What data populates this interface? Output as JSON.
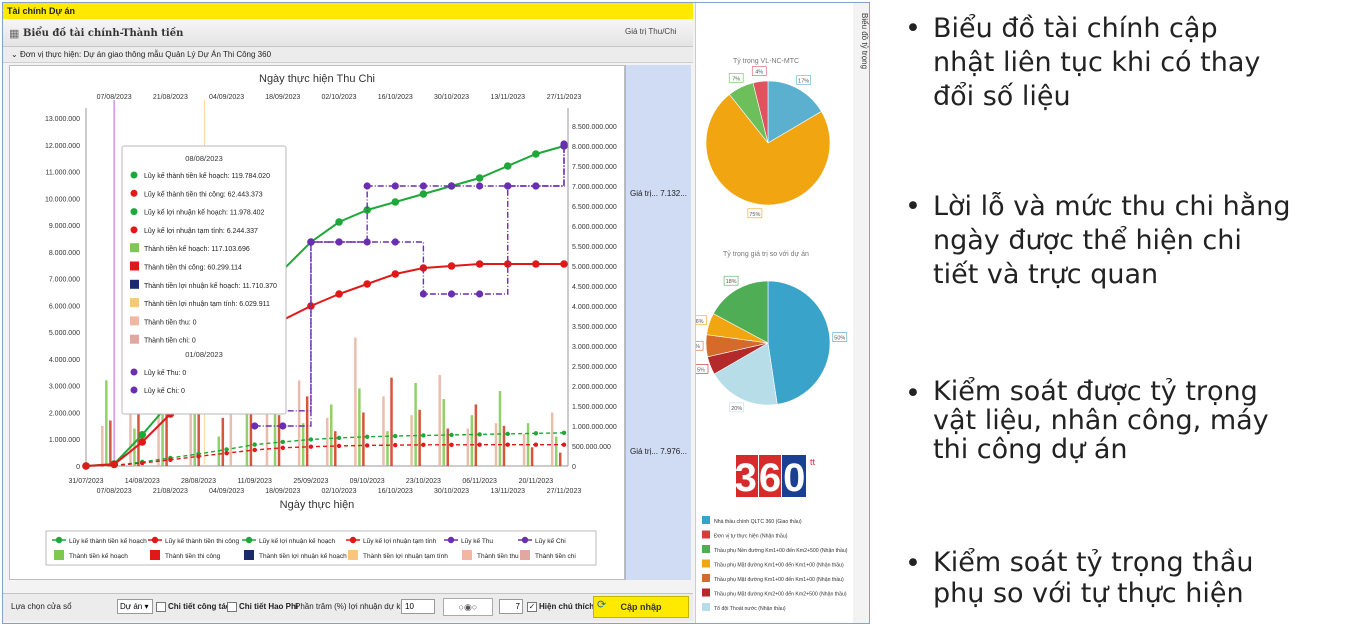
{
  "window": {
    "title": "Tài chính Dự án"
  },
  "panel": {
    "title": "Biểu đồ tài chính-Thành tiền",
    "value_column_header": "Giá trị Thu/Chi",
    "unit_label": "Đơn vị thực hiện: Dự án giao thông mẫu Quản Lý Dự Án Thi Công 360",
    "side_tab_label": "Biểu đồ tỷ trọng"
  },
  "value_column": {
    "row1": "Giá trị... 7.132...",
    "row2": "Giá trị... 7.976..."
  },
  "chart_data": {
    "type": "line",
    "title": "Ngày thực hiện Thu Chi",
    "xlabel": "Ngày thực hiện",
    "x_ticks_top": [
      "07/08/2023",
      "21/08/2023",
      "04/09/2023",
      "18/09/2023",
      "02/10/2023",
      "16/10/2023",
      "30/10/2023",
      "13/11/2023",
      "27/11/2023"
    ],
    "x_ticks_bottom_a": [
      "31/07/2023",
      "14/08/2023",
      "28/08/2023",
      "11/09/2023",
      "25/09/2023",
      "09/10/2023",
      "23/10/2023",
      "06/11/2023",
      "20/11/2023"
    ],
    "x_ticks_bottom_b": [
      "07/08/2023",
      "21/08/2023",
      "04/09/2023",
      "18/09/2023",
      "02/10/2023",
      "16/10/2023",
      "30/10/2023",
      "13/11/2023",
      "27/11/2023"
    ],
    "y_left_ticks": [
      "0",
      "1.000.000",
      "2.000.000",
      "3.000.000",
      "4.000.000",
      "5.000.000",
      "6.000.000",
      "7.000.000",
      "8.000.000",
      "9.000.000",
      "10.000.000",
      "11.000.000",
      "12.000.000",
      "13.000.000"
    ],
    "y_right_ticks": [
      "0",
      "500.000.000",
      "1.000.000.000",
      "1.500.000.000",
      "2.000.000.000",
      "2.500.000.000",
      "3.000.000.000",
      "3.500.000.000",
      "4.000.000.000",
      "4.500.000.000",
      "5.000.000.000",
      "5.500.000.000",
      "6.000.000.000",
      "6.500.000.000",
      "7.000.000.000",
      "7.500.000.000",
      "8.000.000.000",
      "8.500.000.000"
    ],
    "ylim_left": [
      0,
      13000000
    ],
    "ylim_right": [
      0,
      8700000000
    ],
    "series": [
      {
        "name": "Lũy kế thành tiền kế hoạch",
        "color": "#1fa83a",
        "axis": "right",
        "style": "solid",
        "x": [
          0,
          7,
          14,
          21,
          28,
          35,
          42,
          49,
          56,
          63,
          70,
          77,
          84,
          91,
          98,
          105,
          112,
          119
        ],
        "values": [
          0,
          50000000,
          780000000,
          1600000000,
          2500000000,
          3200000000,
          4100000000,
          4900000000,
          5600000000,
          6100000000,
          6400000000,
          6600000000,
          6800000000,
          7000000000,
          7200000000,
          7500000000,
          7800000000,
          8000000000
        ]
      },
      {
        "name": "Lũy kế thành tiền thi công",
        "color": "#e01818",
        "axis": "right",
        "style": "solid",
        "x": [
          0,
          7,
          14,
          21,
          28,
          35,
          42,
          49,
          56,
          63,
          70,
          77,
          84,
          91,
          98,
          105,
          112,
          119
        ],
        "values": [
          0,
          40000000,
          600000000,
          1300000000,
          2000000000,
          2600000000,
          3200000000,
          3650000000,
          4000000000,
          4300000000,
          4550000000,
          4800000000,
          4950000000,
          5000000000,
          5050000000,
          5050000000,
          5050000000,
          5050000000
        ]
      },
      {
        "name": "Lũy kế lợi nhuận kế hoạch",
        "color": "#1fa83a",
        "axis": "left",
        "style": "dashed",
        "x": [
          0,
          7,
          14,
          21,
          28,
          35,
          42,
          49,
          56,
          63,
          70,
          77,
          84,
          91,
          98,
          105,
          112,
          119
        ],
        "values": [
          0,
          20000,
          150000,
          300000,
          450000,
          620000,
          800000,
          900000,
          990000,
          1050000,
          1090000,
          1120000,
          1140000,
          1160000,
          1180000,
          1200000,
          1220000,
          1240000
        ]
      },
      {
        "name": "Lũy kế lợi nhuận tạm tính",
        "color": "#e01818",
        "axis": "left",
        "style": "dashed",
        "x": [
          0,
          7,
          14,
          21,
          28,
          35,
          42,
          49,
          56,
          63,
          70,
          77,
          84,
          91,
          98,
          105,
          112,
          119
        ],
        "values": [
          0,
          15000,
          110000,
          230000,
          360000,
          480000,
          600000,
          680000,
          720000,
          750000,
          770000,
          780000,
          790000,
          790000,
          795000,
          795000,
          795000,
          795000
        ]
      },
      {
        "name": "Lũy kế Thu",
        "color": "#6a2fb0",
        "axis": "right",
        "style": "dashdot",
        "x": [
          42,
          49,
          56,
          63,
          70,
          77,
          84,
          91,
          98,
          105,
          112,
          119
        ],
        "values": [
          1380000000,
          1380000000,
          5600000000,
          5600000000,
          5600000000,
          5600000000,
          4300000000,
          4300000000,
          4300000000,
          7000000000,
          7000000000,
          8000000000
        ]
      },
      {
        "name": "Lũy kế Chi",
        "color": "#6a2fb0",
        "axis": "right",
        "style": "dashdot",
        "x": [
          42,
          49,
          56,
          63,
          70,
          77,
          84,
          91,
          98,
          105,
          112,
          119
        ],
        "values": [
          1000000000,
          1000000000,
          5600000000,
          5600000000,
          7000000000,
          7000000000,
          7000000000,
          7000000000,
          7000000000,
          7000000000,
          7000000000,
          8050000000
        ]
      }
    ],
    "bars": {
      "Thành tiền kế hoạch": {
        "color": "#7ec850",
        "x": [
          5,
          12,
          19,
          27,
          33,
          40,
          47,
          54,
          61,
          68,
          75,
          82,
          89,
          96,
          103,
          110,
          117
        ],
        "values": [
          3200000,
          1400000,
          2400000,
          3800000,
          1100000,
          2600000,
          3400000,
          1600000,
          2300000,
          2900000,
          1300000,
          3100000,
          2500000,
          1900000,
          2800000,
          1600000,
          1100000
        ]
      },
      "Thành tiền thi công": {
        "color": "#cc3a1a",
        "x": [
          6,
          13,
          20,
          28,
          34,
          41,
          48,
          55,
          62,
          69,
          76,
          83,
          90,
          97,
          104,
          111,
          118
        ],
        "values": [
          1700000,
          2600000,
          3300000,
          2500000,
          1800000,
          3700000,
          1900000,
          2600000,
          1300000,
          2000000,
          3300000,
          2100000,
          1400000,
          2300000,
          1500000,
          700000,
          500000
        ]
      },
      "Thành tiền chi": {
        "color": "#e6b3a0",
        "x": [
          4,
          11,
          18,
          26,
          36,
          45,
          53,
          60,
          67,
          74,
          81,
          88,
          95,
          102,
          109,
          116
        ],
        "values": [
          1500000,
          2100000,
          4100000,
          8600000,
          6500000,
          11800000,
          3200000,
          1800000,
          4800000,
          2600000,
          1900000,
          3400000,
          1400000,
          1600000,
          1200000,
          2000000
        ]
      }
    },
    "tooltip": {
      "date1": "08/08/2023",
      "items1": [
        {
          "label": "Lũy kế thành tiền kế hoạch: 119.784.020",
          "color": "#1fa83a",
          "marker": "dot"
        },
        {
          "label": "Lũy kế thành tiền thi công: 62.443.373",
          "color": "#e01818",
          "marker": "dot"
        },
        {
          "label": "Lũy kế lợi nhuận kế hoạch: 11.978.402",
          "color": "#1fa83a",
          "marker": "dot"
        },
        {
          "label": "Lũy kế lợi nhuận tạm tính: 6.244.337",
          "color": "#e01818",
          "marker": "dot"
        },
        {
          "label": "Thành tiền kế hoạch: 117.103.696",
          "color": "#7ec850",
          "marker": "square"
        },
        {
          "label": "Thành tiền thi công: 60.299.114",
          "color": "#e01818",
          "marker": "square"
        },
        {
          "label": "Thành tiền lợi nhuận kế hoạch: 11.710.370",
          "color": "#1b2a6b",
          "marker": "square"
        },
        {
          "label": "Thành tiền lợi nhuận tạm tính: 6.029.911",
          "color": "#f7c77a",
          "marker": "square"
        },
        {
          "label": "Thành tiền thu: 0",
          "color": "#f2b7a2",
          "marker": "square"
        },
        {
          "label": "Thành tiền chi: 0",
          "color": "#e0a8a0",
          "marker": "square"
        }
      ],
      "date2": "01/08/2023",
      "items2": [
        {
          "label": "Lũy kế Thu: 0",
          "color": "#6a2fb0",
          "marker": "dot"
        },
        {
          "label": "Lũy kế Chi: 0",
          "color": "#6a2fb0",
          "marker": "dot"
        }
      ]
    },
    "legend": [
      {
        "label": "Lũy kế thành tiền kế hoạch",
        "color": "#1fa83a",
        "marker": "line-dot"
      },
      {
        "label": "Lũy kế thành tiền thi công",
        "color": "#e01818",
        "marker": "line-dot"
      },
      {
        "label": "Lũy kế lợi nhuận kế hoạch",
        "color": "#1fa83a",
        "marker": "line-dot"
      },
      {
        "label": "Lũy kế lợi nhuận tạm tính",
        "color": "#e01818",
        "marker": "line-dot"
      },
      {
        "label": "Lũy kế Thu",
        "color": "#6a2fb0",
        "marker": "line-dot"
      },
      {
        "label": "Lũy kế Chi",
        "color": "#6a2fb0",
        "marker": "line-dot"
      },
      {
        "label": "Thành tiền kế hoạch",
        "color": "#7ec850",
        "marker": "square"
      },
      {
        "label": "Thành tiền thi công",
        "color": "#e01818",
        "marker": "square"
      },
      {
        "label": "Thành tiền lợi nhuận kế hoạch",
        "color": "#1b2a6b",
        "marker": "square"
      },
      {
        "label": "Thành tiền lợi nhuận tạm tính",
        "color": "#f7c77a",
        "marker": "square"
      },
      {
        "label": "Thành tiền thu",
        "color": "#f2b7a2",
        "marker": "square"
      },
      {
        "label": "Thành tiền chi",
        "color": "#e0a8a0",
        "marker": "square"
      }
    ],
    "legend_placement": "bottom",
    "grid": false
  },
  "pie1": {
    "title": "Tỷ trọng VL-NC-MTC",
    "slices": [
      {
        "label": "17%",
        "value": 17,
        "color": "#5bb0cf"
      },
      {
        "label": "75%",
        "value": 75,
        "color": "#f0a511"
      },
      {
        "label": "7%",
        "value": 7,
        "color": "#6dbf5b"
      },
      {
        "label": "4%",
        "value": 4,
        "color": "#e0525e"
      }
    ]
  },
  "pie2": {
    "title": "Tỷ trọng giá trị so với dự án",
    "slices": [
      {
        "label": "50%",
        "value": 50,
        "color": "#3aa3c9"
      },
      {
        "label": "20%",
        "value": 20,
        "color": "#b7dde8"
      },
      {
        "label": "5%",
        "value": 5,
        "color": "#b42a2a"
      },
      {
        "label": "6%",
        "value": 6,
        "color": "#d56a2a"
      },
      {
        "label": "6%",
        "value": 6,
        "color": "#f0a511"
      },
      {
        "label": "18%",
        "value": 18,
        "color": "#4fae55"
      }
    ]
  },
  "logo": {
    "text": "360",
    "superscript": "tt"
  },
  "pie_legend": [
    {
      "label": "Nhà thầu chính QLTC 360 (Giao thầu)",
      "color": "#3aa3c9"
    },
    {
      "label": "Đơn vị tự thực hiện (Nhận thầu)",
      "color": "#d63c3c"
    },
    {
      "label": "Thầu phụ Nền đường Km1+00 đến Km2+500 (Nhận thầu)",
      "color": "#4fae55"
    },
    {
      "label": "Thầu phụ Mặt đường Km1+00 đến Km1+00 (Nhận thầu)",
      "color": "#f0a511"
    },
    {
      "label": "Thầu phụ Mặt đường Km1+00 đến Km1+00 (Nhận thầu)",
      "color": "#d56a2a"
    },
    {
      "label": "Thầu phụ Mặt đường Km2+00 đến Km2+500 (Nhận thầu)",
      "color": "#b42a2a"
    },
    {
      "label": "Tổ đội Thoát nước (Nhận thầu)",
      "color": "#b7dde8"
    }
  ],
  "bottom_bar": {
    "select_label": "Lựa chọn cửa sổ",
    "dropdown_value": "Dự án",
    "chk_detail_work": "Chi tiết công tác",
    "chk_detail_cost": "Chi tiết Hao Phí",
    "pct_label": "Phần trăm (%) lợi nhuận dự kiến",
    "pct_value": "10",
    "radio_glyphs": "○◉○",
    "num_value": "7",
    "chk_show_notes": "Hiện chú thích",
    "update_button": "Cập nhập"
  },
  "bullets": [
    {
      "line1": "Biểu đồ tài chính cập",
      "line2": "nhật liên tục khi có thay",
      "line3": "đổi số liệu"
    },
    {
      "line1": "Lời lỗ và mức thu chi hằng",
      "line2": "ngày được thể hiện chi",
      "line3": "tiết và trực quan"
    },
    {
      "line1": "Kiểm soát được tỷ trọng",
      "line2": "vật liệu, nhân công, máy",
      "line3": "thi công dự án"
    },
    {
      "line1": "Kiểm soát tỷ trọng thầu",
      "line2": "phụ so với tự thực hiện",
      "line3": ""
    }
  ]
}
